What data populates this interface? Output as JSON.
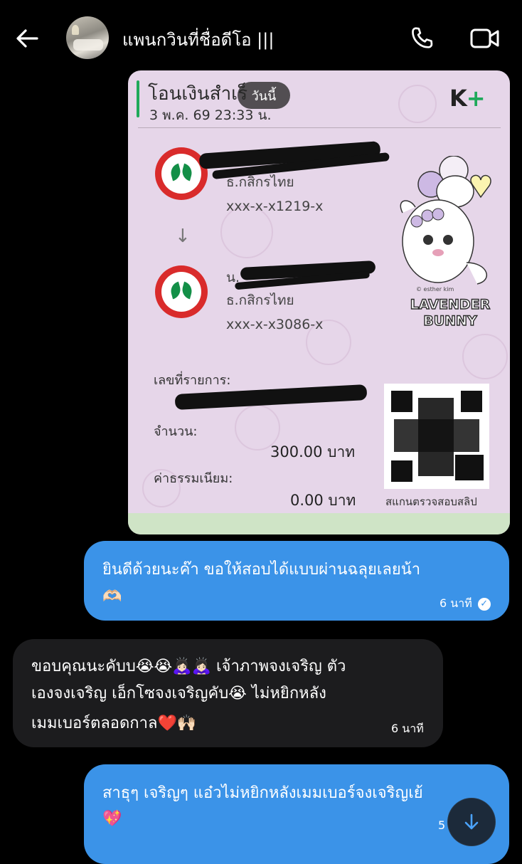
{
  "header": {
    "contact_name": "แพนกวินที่ชื่อดีโอ |||"
  },
  "slip": {
    "title": "โอนเงินสำเร็",
    "date": "3 พ.ค. 69  23:33 น.",
    "today_chip": "วันนี้",
    "brand": "K",
    "brand_plus": "+",
    "sender_bank": "ธ.กสิกรไทย",
    "sender_account": "xxx-x-x1219-x",
    "receiver_prefix": "น.",
    "receiver_bank": "ธ.กสิกรไทย",
    "receiver_account": "xxx-x-x3086-x",
    "ref_label": "เลขที่รายการ:",
    "amount_label": "จำนวน:",
    "amount_value": "300.00 บาท",
    "fee_label": "ค่าธรรมเนียม:",
    "fee_value": "0.00 บาท",
    "qr_caption": "สแกนตรวจสอบสลิป",
    "sticker_text_1": "LAVENDER",
    "sticker_text_2": "BUNNY",
    "sticker_credit": "© esther kim"
  },
  "messages": [
    {
      "direction": "outgoing",
      "lines": [
        "ยินดีด้วยนะค๊า ขอให้สอบได้แบบผ่านฉลุยเลยน้า"
      ],
      "emoji_line": "🫶🏻",
      "time": "6 นาที",
      "read": true
    },
    {
      "direction": "incoming",
      "lines": [
        "ขอบคุณนะคับบ😭😭🙇🏻‍♀️🙇🏻‍♀️ เจ้าภาพจงเจริญ ตัว",
        "เองจงเจริญ เอ็กโซจงเจริญคับ😭 ไม่หยิกหลัง",
        "เมมเบอร์ตลอดกาล❤️🙌🏻"
      ],
      "time": "6 นาที"
    },
    {
      "direction": "outgoing",
      "lines": [
        "สาธุๆ เจริญๆ แอ๋วไม่หยิกหลังเมมเบอร์จงเจริญเย้"
      ],
      "emoji_line": "💖",
      "time": "5"
    }
  ],
  "colors": {
    "outgoing_bubble": "#3b93e8",
    "incoming_bubble": "#1c1c1e",
    "kbank_green": "#1fa95a",
    "kbank_red": "#d92b2b"
  },
  "icons": {
    "back": "back-arrow-icon",
    "call": "phone-icon",
    "video": "video-camera-icon",
    "scroll_down": "arrow-down-icon",
    "read": "check-circle-icon"
  }
}
